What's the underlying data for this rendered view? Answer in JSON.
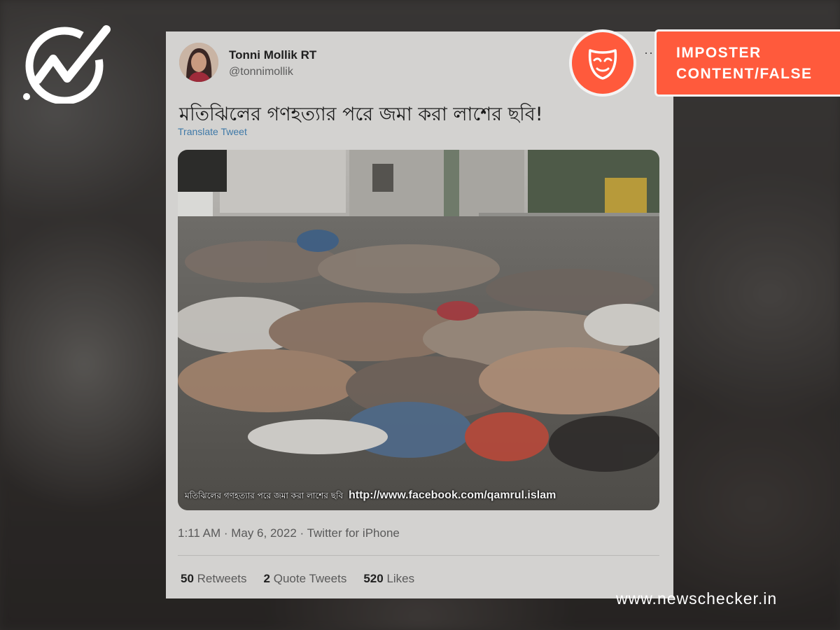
{
  "tweet": {
    "author_name": "Tonni Mollik RT",
    "author_handle": "@tonnimollik",
    "more_label": "···",
    "text": "মতিঝিলের গণহত্যার পরে জমা করা লাশের ছবি!",
    "translate_label": "Translate Tweet",
    "photo_caption_text": "মতিঝিলের গণহত্যার পরে জমা করা লাশের ছবি",
    "photo_caption_url": "http://www.facebook.com/qamrul.islam",
    "timestamp": "1:11 AM · May 6, 2022 · Twitter for iPhone",
    "stats": {
      "retweets_count": "50",
      "retweets_label": "Retweets",
      "quotes_count": "2",
      "quotes_label": "Quote Tweets",
      "likes_count": "520",
      "likes_label": "Likes"
    }
  },
  "verdict": {
    "line1": "IMPOSTER",
    "line2": "CONTENT/FALSE",
    "badge_icon": "mask-icon",
    "color": "#ff5a3c"
  },
  "branding": {
    "logo_icon": "checkmark-logo-icon",
    "website": "www.newschecker.in"
  }
}
